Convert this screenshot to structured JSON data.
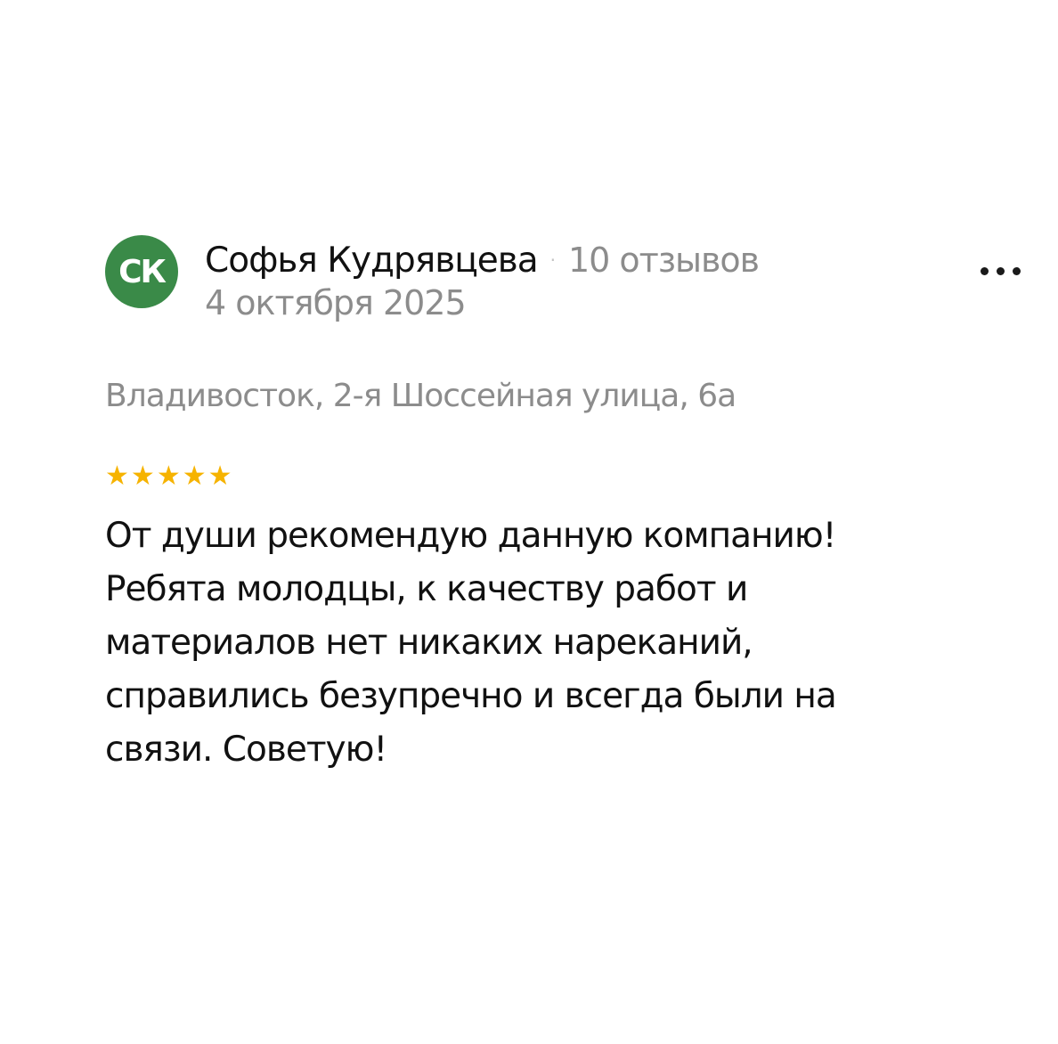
{
  "review": {
    "author": {
      "initials": "СК",
      "name": "Софья Кудрявцева",
      "reviews_count": "10 отзывов",
      "avatar_color": "#3a8a48"
    },
    "separator": "·",
    "date": "4 октября 2025",
    "address": "Владивосток, 2-я Шоссейная улица, 6а",
    "rating": 5,
    "star_glyph": "★",
    "star_color": "#f6b300",
    "text": "От души рекомендую данную компанию! Ребята молодцы, к качеству работ и материалов нет никаких нареканий, справились безупречно и всегда были на связи. Советую!",
    "more_icon": "more-dots-icon"
  }
}
